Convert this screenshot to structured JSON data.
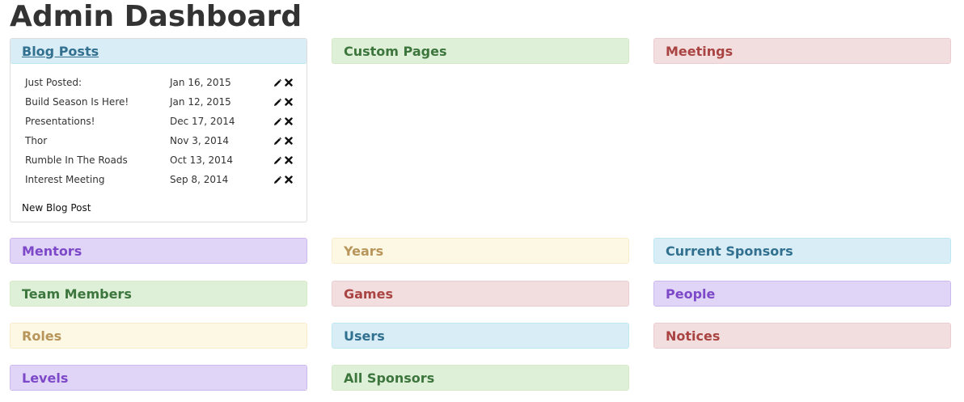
{
  "page": {
    "title": "Admin Dashboard"
  },
  "blog": {
    "heading": "Blog Posts",
    "posts": [
      {
        "title": "Just Posted:",
        "date": "Jan 16, 2015"
      },
      {
        "title": "Build Season Is Here!",
        "date": "Jan 12, 2015"
      },
      {
        "title": "Presentations!",
        "date": "Dec 17, 2014"
      },
      {
        "title": "Thor",
        "date": "Nov 3, 2014"
      },
      {
        "title": "Rumble In The Roads",
        "date": "Oct 13, 2014"
      },
      {
        "title": "Interest Meeting",
        "date": "Sep 8, 2014"
      }
    ],
    "row_icons": [
      "pencil-icon",
      "close-icon"
    ],
    "new_post_label": "New Blog Post"
  },
  "panels": {
    "custom_pages": "Custom Pages",
    "meetings": "Meetings",
    "mentors": "Mentors",
    "years": "Years",
    "current_sponsors": "Current Sponsors",
    "team_members": "Team Members",
    "games": "Games",
    "people": "People",
    "roles": "Roles",
    "users": "Users",
    "notices": "Notices",
    "levels": "Levels",
    "all_sponsors": "All Sponsors"
  },
  "colors": {
    "info": "#31708f",
    "success": "#3c763d",
    "danger": "#a94442",
    "warning": "#b8955a",
    "purple": "#7d49c8"
  }
}
